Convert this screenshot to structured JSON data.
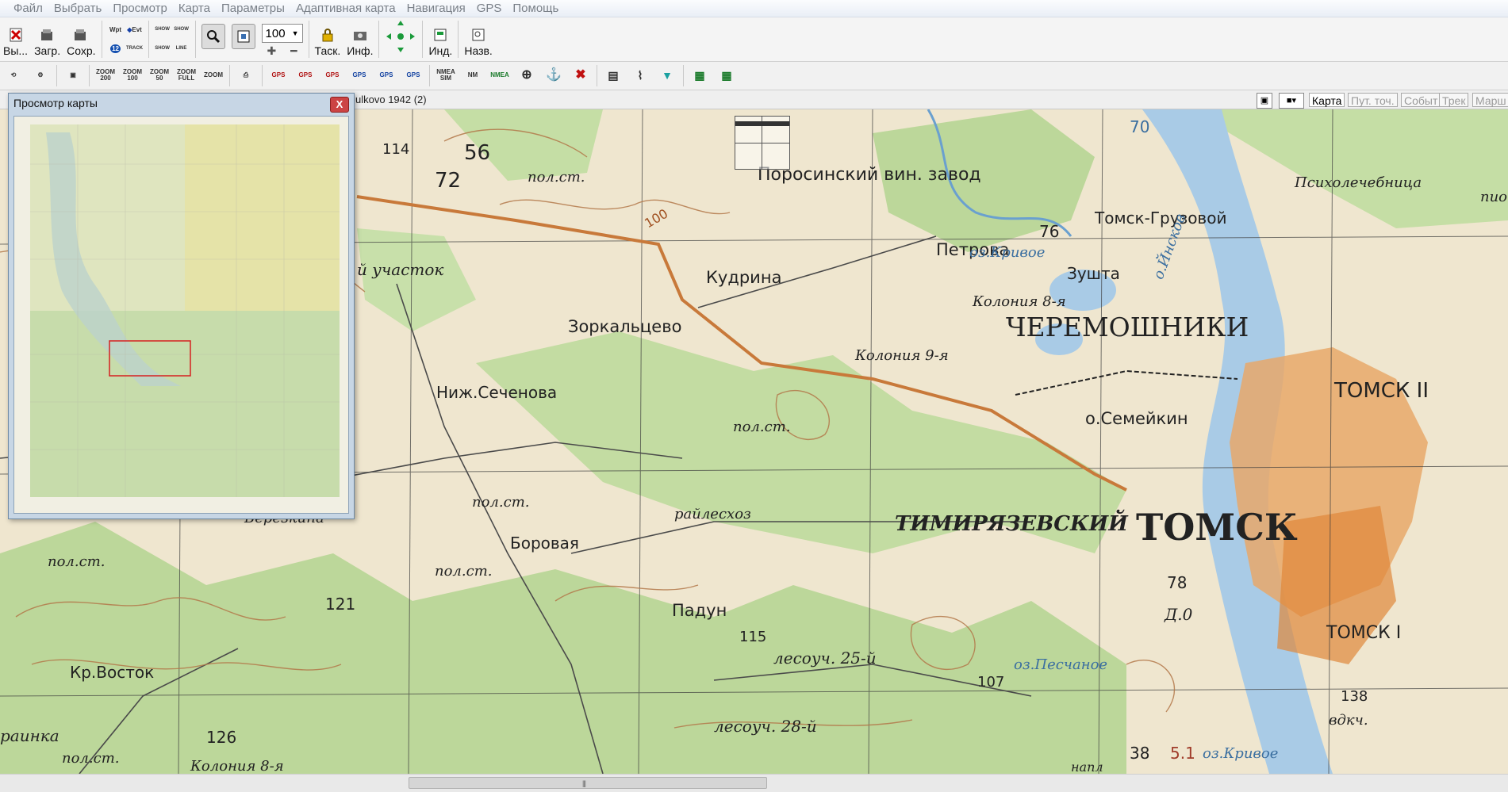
{
  "menu": [
    "Файл",
    "Выбрать",
    "Просмотр",
    "Карта",
    "Параметры",
    "Адаптивная карта",
    "Навигация",
    "GPS",
    "Помощь"
  ],
  "toolbar1": {
    "exit_label": "Вы...",
    "load_label": "Загр.",
    "save_label": "Сохр.",
    "wpt_label": "Wpt",
    "evt_label": "Evt",
    "track_label": "TRACK",
    "show_label": "SHOW",
    "line_label": "LINE",
    "zoom_value": "100",
    "task_label": "Таск.",
    "info_label": "Инф.",
    "index_label": "Инд.",
    "names_label": "Назв."
  },
  "toolbar2": {
    "zoom200": "ZOOM 200",
    "zoom100": "ZOOM 100",
    "zoom50": "ZOOM 50",
    "zoomfull": "ZOOM FULL",
    "zoom": "ZOOM",
    "gps": "GPS",
    "nmea_sim": "NMEA SIM",
    "nm": "NM",
    "nmea": "NMEA"
  },
  "mapbar": {
    "title": "ulkovo 1942 (2)",
    "tabs": [
      "Карта",
      "Пут. точ.",
      "Событ",
      "Трек",
      "Марш"
    ],
    "active_tab": "Карта"
  },
  "overview": {
    "title": "Просмотр карты",
    "close_label": "X"
  },
  "map_labels": {
    "porosinsky": "Поросинский вин. завод",
    "pol_st": "пол.ст.",
    "kudrina": "Кудрина",
    "petrova": "Петрова",
    "tomsk_gruzovoy": "Томск-Грузовой",
    "psikhol": "Психолечебница",
    "pion": "пион",
    "zorkaltsevo": "Зоркальцево",
    "cheremoshniki": "ЧЕРЕМОШНИКИ",
    "koloniya8": "Колония 8-я",
    "koloniya9": "Колония 9-я",
    "ozkrivoe": "оз.Кривое",
    "zushta": "Зушта",
    "oinskov": "о.Йнсков",
    "nizh_sechenova": "Ниж.Сеченова",
    "uchastok": "й участок",
    "tomsk_ii": "ТОМСК II",
    "semeykin": "о.Семейкин",
    "timiryazevsky": "ТИМИРЯЗЕВСКИЙ",
    "tomsk": "ТОМСК",
    "borovaya": "Боровая",
    "raylesxoz": "райлесхоз",
    "padun": "Падун",
    "lesouch25": "лесоуч. 25-й",
    "ozpeschanoe": "оз.Песчаное",
    "kr_vostok": "Кр.Восток",
    "lesouch28": "лесоуч. 28-й",
    "tomsk_i": "ТОМСК I",
    "vdkch": "вдкч.",
    "do": "Д.0",
    "raynka": "раинка",
    "kolonia8b": "Колония 8-я",
    "bereznik": "Березкина",
    "ozkrivoe2": "оз.Кривое",
    "napl": "напл",
    "n56": "56",
    "n72": "72",
    "n114": "114",
    "n70": "70",
    "n76": "76",
    "n78": "78",
    "n121": "121",
    "n126": "126",
    "n115": "115",
    "n107": "107",
    "n138": "138",
    "n38": "38",
    "n51": "5.1",
    "n100": "100"
  },
  "colors": {
    "forest": "#bcd79a",
    "field": "#efe6cf",
    "river": "#a9cbe6",
    "road": "#c8793a",
    "city": "#e0873a",
    "contour": "#b3784a"
  }
}
